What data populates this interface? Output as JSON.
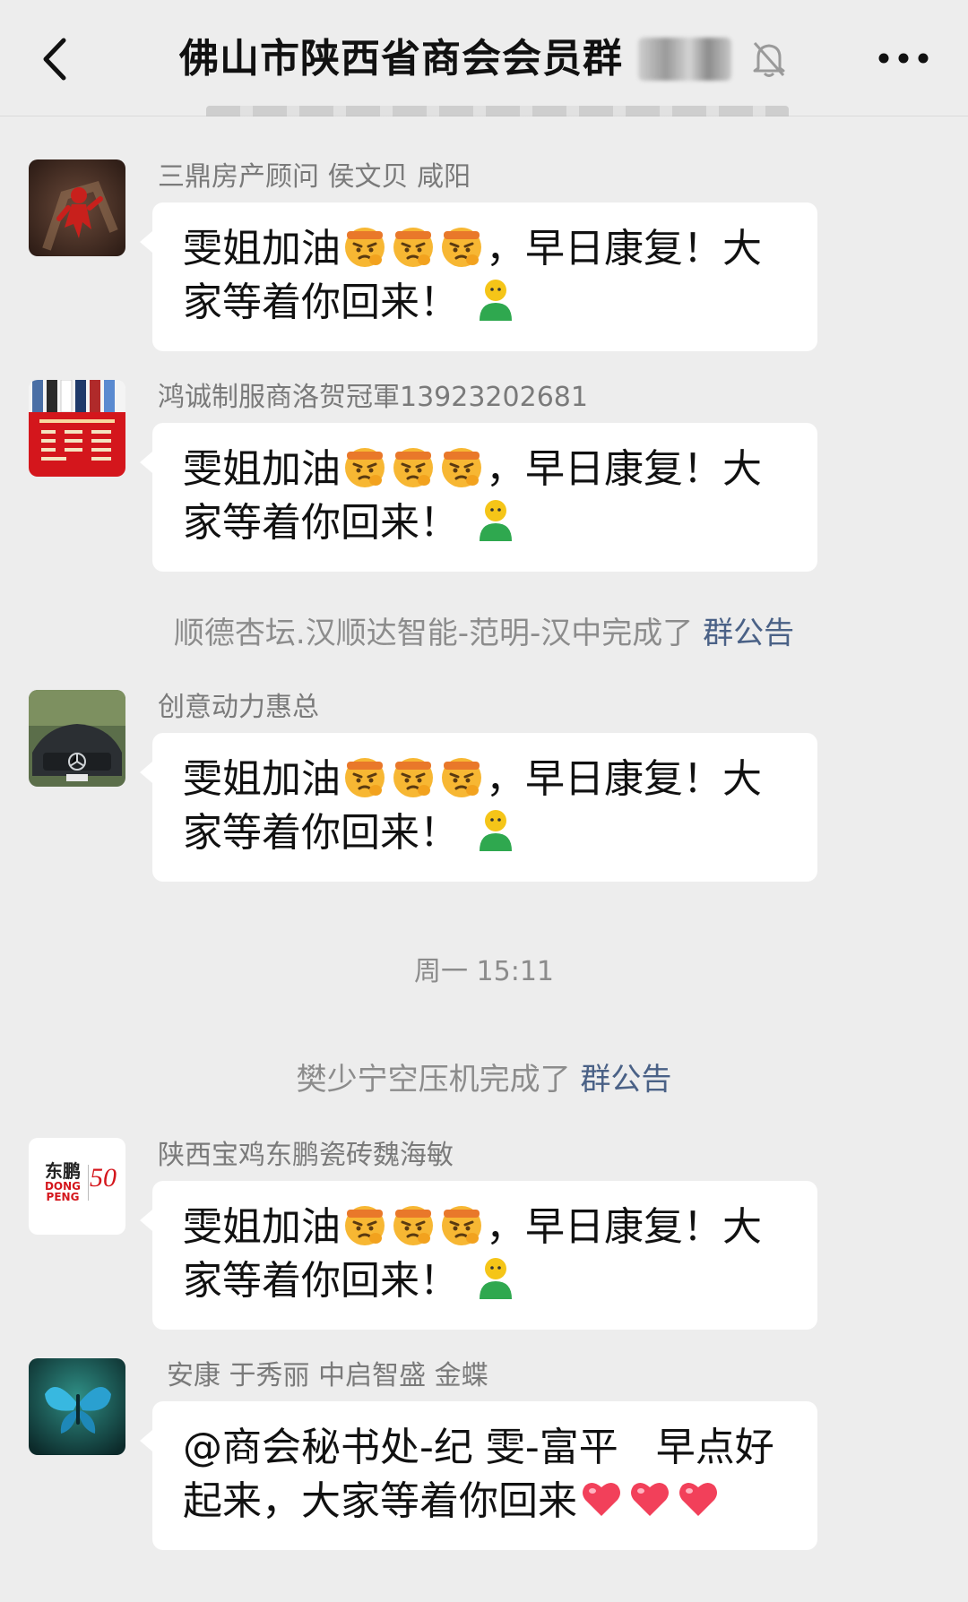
{
  "header": {
    "title": "佛山市陕西省商会会员群",
    "back_icon": "chevron-left-icon",
    "mute_icon": "bell-off-icon",
    "more_icon": "ellipsis-icon"
  },
  "messages": [
    {
      "sender": "三鼎房产顾问 侯文贝 咸阳",
      "line1_text": "雯姐加油",
      "line1_tail": "，早日康复！大",
      "line2_text": "家等着你回来！"
    },
    {
      "sender": "鸿诚制服商洛贺冠軍13923202681",
      "line1_text": "雯姐加油",
      "line1_tail": "，早日康复！大",
      "line2_text": "家等着你回来！"
    },
    {
      "sender": "创意动力惠总",
      "line1_text": "雯姐加油",
      "line1_tail": "，早日康复！大",
      "line2_text": "家等着你回来！"
    },
    {
      "sender": "陕西宝鸡东鹏瓷砖魏海敏",
      "line1_text": "雯姐加油",
      "line1_tail": "，早日康复！大",
      "line2_text": "家等着你回来！"
    },
    {
      "sender": "安康  于秀丽 中启智盛  金蝶",
      "line1_text": "@商会秘书处-纪 雯-富平   早点好",
      "line2_text": "起来，大家等着你回来"
    }
  ],
  "system": [
    {
      "text": "顺德杏坛.汉顺达智能-范明-汉中完成了 ",
      "link": "群公告"
    },
    {
      "text": "樊少宁空压机完成了 ",
      "link": "群公告"
    }
  ],
  "timestamp": "周一 15:11",
  "avatar4": {
    "brand_cn": "东鹏",
    "brand_en1": "DONG",
    "brand_en2": "PENG",
    "badge": "50"
  },
  "colors": {
    "background": "#ededed",
    "bubble": "#ffffff",
    "link": "#4a6186",
    "sender": "#7a7a7a"
  }
}
